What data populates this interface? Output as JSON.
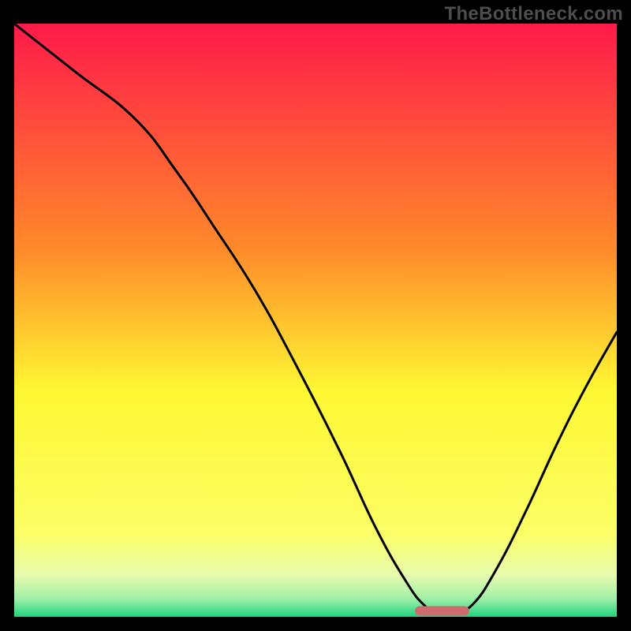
{
  "watermark": "TheBottleneck.com",
  "chart_data": {
    "type": "line",
    "title": "",
    "xlabel": "",
    "ylabel": "",
    "xlim": [
      0,
      100
    ],
    "ylim": [
      0,
      100
    ],
    "grid": false,
    "legend": false,
    "background_gradient": {
      "top": "#ff1a4a",
      "mid_upper": "#ffb02a",
      "mid": "#fff833",
      "mid_lower": "#f6fc7a",
      "band_pale": "#e4fbc0",
      "bottom": "#1fd37e"
    },
    "series": [
      {
        "name": "bottleneck-curve",
        "color": "#000000",
        "x": [
          0,
          10,
          20,
          27,
          33,
          40,
          47,
          54,
          60,
          65,
          68,
          70,
          73,
          76,
          80,
          85,
          90,
          95,
          100
        ],
        "y": [
          100,
          92,
          84,
          75,
          66,
          55,
          42,
          28,
          15,
          6,
          2,
          1,
          1,
          2,
          8,
          18,
          29,
          39,
          48
        ]
      }
    ],
    "marker": {
      "name": "optimal-range",
      "color": "#cf6b6e",
      "x_center": 71,
      "y": 1,
      "width_pct": 9,
      "height_pct": 1.6,
      "rx_pct": 0.8
    }
  }
}
